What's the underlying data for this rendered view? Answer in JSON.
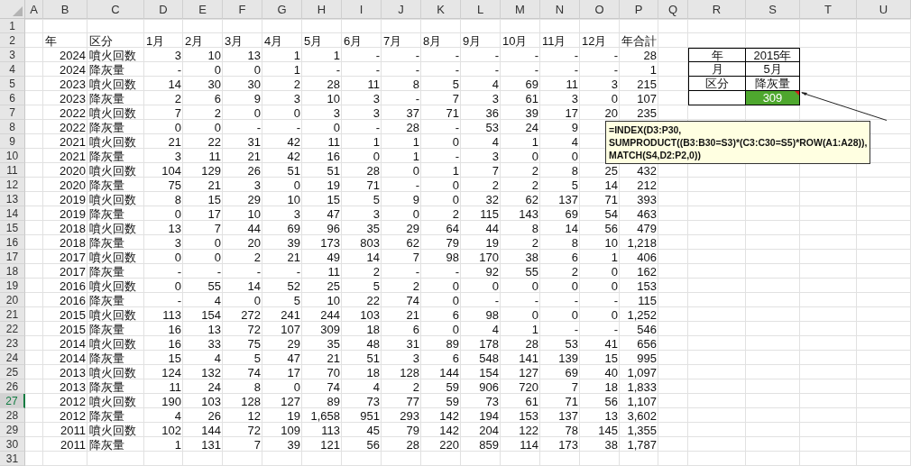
{
  "column_headers": [
    "A",
    "B",
    "C",
    "D",
    "E",
    "F",
    "G",
    "H",
    "I",
    "J",
    "K",
    "L",
    "M",
    "N",
    "O",
    "P",
    "Q",
    "R",
    "S",
    "T",
    "U"
  ],
  "row_headers": [
    {
      "label": "1",
      "selected": false
    },
    {
      "label": "2",
      "selected": false
    },
    {
      "label": "3",
      "selected": false
    },
    {
      "label": "4",
      "selected": false
    },
    {
      "label": "5",
      "selected": false
    },
    {
      "label": "6",
      "selected": false
    },
    {
      "label": "7",
      "selected": false
    },
    {
      "label": "8",
      "selected": false
    },
    {
      "label": "9",
      "selected": false
    },
    {
      "label": "10",
      "selected": false
    },
    {
      "label": "11",
      "selected": false
    },
    {
      "label": "12",
      "selected": false
    },
    {
      "label": "13",
      "selected": false
    },
    {
      "label": "14",
      "selected": false
    },
    {
      "label": "15",
      "selected": false
    },
    {
      "label": "16",
      "selected": false
    },
    {
      "label": "17",
      "selected": false
    },
    {
      "label": "18",
      "selected": false
    },
    {
      "label": "19",
      "selected": false
    },
    {
      "label": "20",
      "selected": false
    },
    {
      "label": "21",
      "selected": false
    },
    {
      "label": "22",
      "selected": false
    },
    {
      "label": "23",
      "selected": false
    },
    {
      "label": "24",
      "selected": false
    },
    {
      "label": "25",
      "selected": false
    },
    {
      "label": "26",
      "selected": false
    },
    {
      "label": "27",
      "selected": true
    },
    {
      "label": "28",
      "selected": false
    },
    {
      "label": "29",
      "selected": false
    },
    {
      "label": "30",
      "selected": false
    },
    {
      "label": "31",
      "selected": false
    }
  ],
  "table": {
    "columns": [
      "年",
      "区分",
      "1月",
      "2月",
      "3月",
      "4月",
      "5月",
      "6月",
      "7月",
      "8月",
      "9月",
      "10月",
      "11月",
      "12月",
      "年合計"
    ],
    "rows": [
      {
        "year": "2024",
        "category": "噴火回数",
        "values": [
          "3",
          "10",
          "13",
          "1",
          "1",
          "-",
          "-",
          "-",
          "-",
          "-",
          "-",
          "-",
          "28"
        ]
      },
      {
        "year": "2024",
        "category": "降灰量",
        "values": [
          "-",
          "0",
          "0",
          "1",
          "-",
          "-",
          "-",
          "-",
          "-",
          "-",
          "-",
          "-",
          "1"
        ]
      },
      {
        "year": "2023",
        "category": "噴火回数",
        "values": [
          "14",
          "30",
          "30",
          "2",
          "28",
          "11",
          "8",
          "5",
          "4",
          "69",
          "11",
          "3",
          "215"
        ]
      },
      {
        "year": "2023",
        "category": "降灰量",
        "values": [
          "2",
          "6",
          "9",
          "3",
          "10",
          "3",
          "-",
          "7",
          "3",
          "61",
          "3",
          "0",
          "107"
        ]
      },
      {
        "year": "2022",
        "category": "噴火回数",
        "values": [
          "7",
          "2",
          "0",
          "0",
          "3",
          "3",
          "37",
          "71",
          "36",
          "39",
          "17",
          "20",
          "235"
        ]
      },
      {
        "year": "2022",
        "category": "降灰量",
        "values": [
          "0",
          "0",
          "-",
          "-",
          "0",
          "-",
          "28",
          "-",
          "53",
          "24",
          "9"
        ]
      },
      {
        "year": "2021",
        "category": "噴火回数",
        "values": [
          "21",
          "22",
          "31",
          "42",
          "11",
          "1",
          "1",
          "0",
          "4",
          "1",
          "4"
        ]
      },
      {
        "year": "2021",
        "category": "降灰量",
        "values": [
          "3",
          "11",
          "21",
          "42",
          "16",
          "0",
          "1",
          "-",
          "3",
          "0",
          "0"
        ]
      },
      {
        "year": "2020",
        "category": "噴火回数",
        "values": [
          "104",
          "129",
          "26",
          "51",
          "51",
          "28",
          "0",
          "1",
          "7",
          "2",
          "8",
          "25",
          "432"
        ]
      },
      {
        "year": "2020",
        "category": "降灰量",
        "values": [
          "75",
          "21",
          "3",
          "0",
          "19",
          "71",
          "-",
          "0",
          "2",
          "2",
          "5",
          "14",
          "212"
        ]
      },
      {
        "year": "2019",
        "category": "噴火回数",
        "values": [
          "8",
          "15",
          "29",
          "10",
          "15",
          "5",
          "9",
          "0",
          "32",
          "62",
          "137",
          "71",
          "393"
        ]
      },
      {
        "year": "2019",
        "category": "降灰量",
        "values": [
          "0",
          "17",
          "10",
          "3",
          "47",
          "3",
          "0",
          "2",
          "115",
          "143",
          "69",
          "54",
          "463"
        ]
      },
      {
        "year": "2018",
        "category": "噴火回数",
        "values": [
          "13",
          "7",
          "44",
          "69",
          "96",
          "35",
          "29",
          "64",
          "44",
          "8",
          "14",
          "56",
          "479"
        ]
      },
      {
        "year": "2018",
        "category": "降灰量",
        "values": [
          "3",
          "0",
          "20",
          "39",
          "173",
          "803",
          "62",
          "79",
          "19",
          "2",
          "8",
          "10",
          "1,218"
        ]
      },
      {
        "year": "2017",
        "category": "噴火回数",
        "values": [
          "0",
          "0",
          "2",
          "21",
          "49",
          "14",
          "7",
          "98",
          "170",
          "38",
          "6",
          "1",
          "406"
        ]
      },
      {
        "year": "2017",
        "category": "降灰量",
        "values": [
          "-",
          "-",
          "-",
          "-",
          "11",
          "2",
          "-",
          "-",
          "92",
          "55",
          "2",
          "0",
          "162"
        ]
      },
      {
        "year": "2016",
        "category": "噴火回数",
        "values": [
          "0",
          "55",
          "14",
          "52",
          "25",
          "5",
          "2",
          "0",
          "0",
          "0",
          "0",
          "0",
          "153"
        ]
      },
      {
        "year": "2016",
        "category": "降灰量",
        "values": [
          "-",
          "4",
          "0",
          "5",
          "10",
          "22",
          "74",
          "0",
          "-",
          "-",
          "-",
          "-",
          "115"
        ]
      },
      {
        "year": "2015",
        "category": "噴火回数",
        "values": [
          "113",
          "154",
          "272",
          "241",
          "244",
          "103",
          "21",
          "6",
          "98",
          "0",
          "0",
          "0",
          "1,252"
        ]
      },
      {
        "year": "2015",
        "category": "降灰量",
        "values": [
          "16",
          "13",
          "72",
          "107",
          "309",
          "18",
          "6",
          "0",
          "4",
          "1",
          "-",
          "-",
          "546"
        ]
      },
      {
        "year": "2014",
        "category": "噴火回数",
        "values": [
          "16",
          "33",
          "75",
          "29",
          "35",
          "48",
          "31",
          "89",
          "178",
          "28",
          "53",
          "41",
          "656"
        ]
      },
      {
        "year": "2014",
        "category": "降灰量",
        "values": [
          "15",
          "4",
          "5",
          "47",
          "21",
          "51",
          "3",
          "6",
          "548",
          "141",
          "139",
          "15",
          "995"
        ]
      },
      {
        "year": "2013",
        "category": "噴火回数",
        "values": [
          "124",
          "132",
          "74",
          "17",
          "70",
          "18",
          "128",
          "144",
          "154",
          "127",
          "69",
          "40",
          "1,097"
        ]
      },
      {
        "year": "2013",
        "category": "降灰量",
        "values": [
          "11",
          "24",
          "8",
          "0",
          "74",
          "4",
          "2",
          "59",
          "906",
          "720",
          "7",
          "18",
          "1,833"
        ]
      },
      {
        "year": "2012",
        "category": "噴火回数",
        "values": [
          "190",
          "103",
          "128",
          "127",
          "89",
          "73",
          "77",
          "59",
          "73",
          "61",
          "71",
          "56",
          "1,107"
        ]
      },
      {
        "year": "2012",
        "category": "降灰量",
        "values": [
          "4",
          "26",
          "12",
          "19",
          "1,658",
          "951",
          "293",
          "142",
          "194",
          "153",
          "137",
          "13",
          "3,602"
        ]
      },
      {
        "year": "2011",
        "category": "噴火回数",
        "values": [
          "102",
          "144",
          "72",
          "109",
          "113",
          "45",
          "79",
          "142",
          "204",
          "122",
          "78",
          "145",
          "1,355"
        ]
      },
      {
        "year": "2011",
        "category": "降灰量",
        "values": [
          "1",
          "131",
          "7",
          "39",
          "121",
          "56",
          "28",
          "220",
          "859",
          "114",
          "173",
          "38",
          "1,787"
        ]
      }
    ]
  },
  "lookup": {
    "rows": [
      {
        "label": "年",
        "value": "2015年"
      },
      {
        "label": "月",
        "value": "5月"
      },
      {
        "label": "区分",
        "value": "降灰量"
      }
    ],
    "result": {
      "value": "309"
    }
  },
  "comment": {
    "lines": [
      "=INDEX(D3:P30,",
      "SUMPRODUCT((B3:B30=S3)*(C3:C30=S5)*ROW(A1:A28)),",
      "MATCH(S4,D2:P2,0))"
    ]
  }
}
